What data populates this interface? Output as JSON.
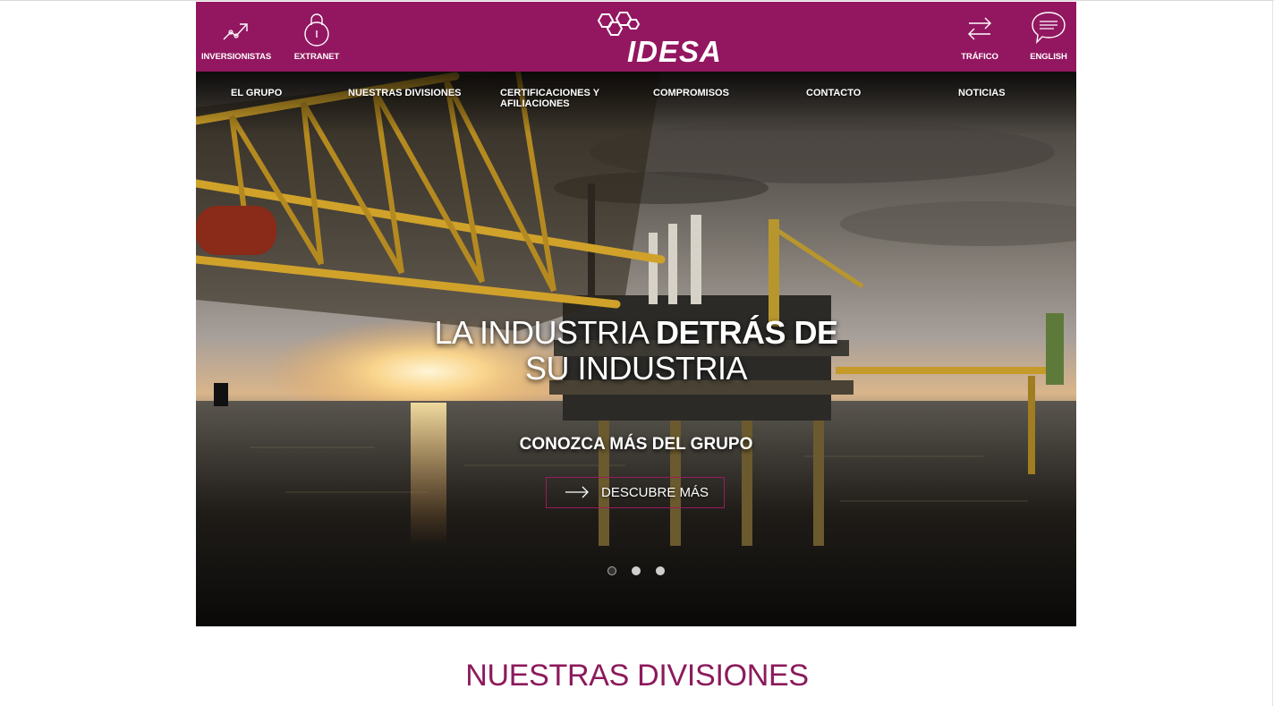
{
  "colors": {
    "brand": "#931760",
    "section_title": "#8c1a5c",
    "cta_border": "#9b1a5e"
  },
  "header": {
    "left_items": [
      {
        "label": "INVERSIONISTAS",
        "icon": "trend-chart-icon"
      },
      {
        "label": "EXTRANET",
        "icon": "padlock-icon"
      }
    ],
    "logo_text": "IDESA",
    "right_items": [
      {
        "label": "TRÁFICO",
        "icon": "exchange-arrows-icon"
      },
      {
        "label": "ENGLISH",
        "icon": "speech-bubble-icon"
      }
    ]
  },
  "nav": {
    "items": [
      {
        "label": "EL GRUPO"
      },
      {
        "label": "NUESTRAS DIVISIONES"
      },
      {
        "label": "CERTIFICACIONES Y AFILIACIONES"
      },
      {
        "label": "COMPROMISOS"
      },
      {
        "label": "CONTACTO"
      },
      {
        "label": "NOTICIAS"
      }
    ]
  },
  "hero": {
    "headline_part1": "LA INDUSTRIA ",
    "headline_part2": "DETRÁS DE",
    "headline_line2": "SU INDUSTRIA",
    "subheading": "CONOZCA MÁS DEL GRUPO",
    "cta_label": "DESCUBRE MÁS",
    "slides_total": 3,
    "active_slide": 1
  },
  "section": {
    "title": "NUESTRAS DIVISIONES"
  }
}
